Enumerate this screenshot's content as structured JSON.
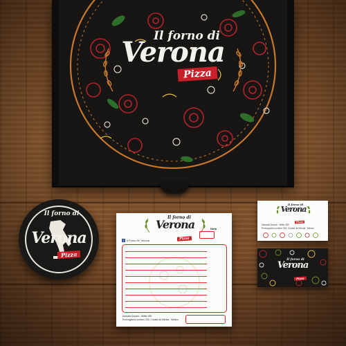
{
  "brand": {
    "script": "Il forno di",
    "name": "Verona",
    "ribbon": "Pizza"
  },
  "notepad": {
    "facebook_label": "Il Forno Di' Verona",
    "note_label": "Nota",
    "address_line_1": "Marsala Duranti - Wilfer 289",
    "address_line_2": "Prolongación ocótero 332, Ciudad de Mérida , México"
  },
  "card": {
    "line_1": "Marsala Duranti - Wilfer 289",
    "line_2": "Prolongación ocótero 332, Ciudad de Mérida , México"
  },
  "colors": {
    "box": "#171615",
    "brand_red": "#c8202a",
    "olive": "#6a8f2a",
    "tomato": "#b3232b",
    "crust": "#c9782b"
  }
}
